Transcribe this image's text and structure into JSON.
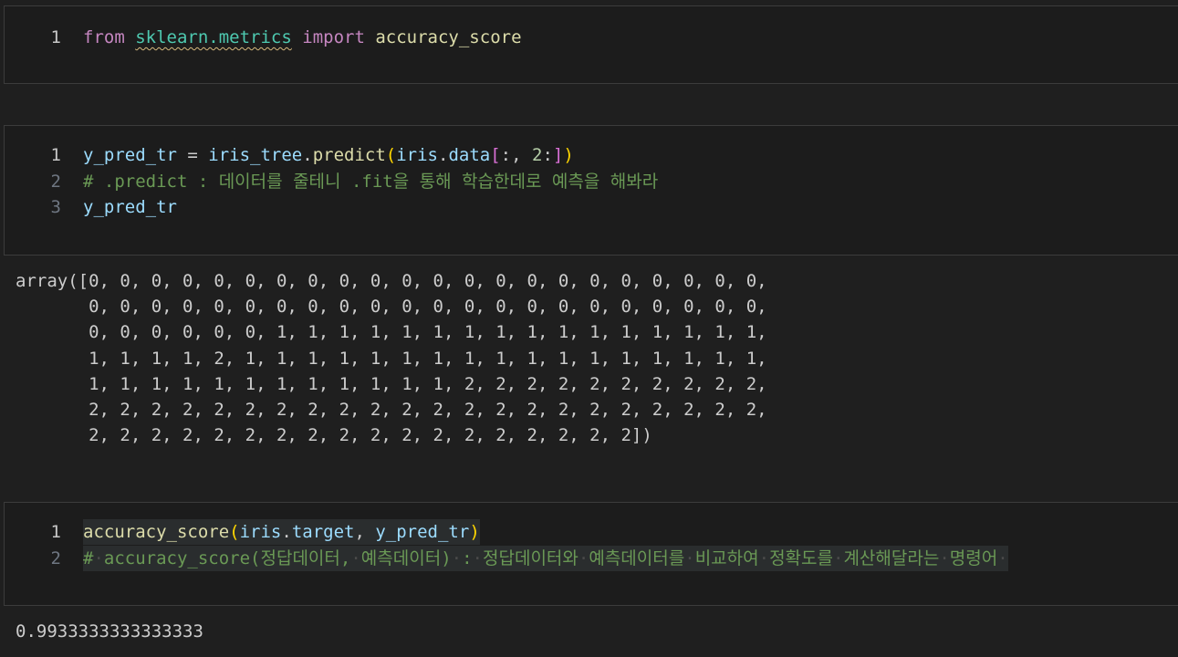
{
  "cells": [
    {
      "lines": [
        {
          "n": "1",
          "t": [
            {
              "c": "kw",
              "s": "from"
            },
            {
              "c": "",
              "s": " "
            },
            {
              "c": "mod squig",
              "s": "sklearn.metrics"
            },
            {
              "c": "",
              "s": " "
            },
            {
              "c": "kw",
              "s": "import"
            },
            {
              "c": "",
              "s": " "
            },
            {
              "c": "fn",
              "s": "accuracy_score"
            }
          ]
        }
      ]
    },
    {
      "lines": [
        {
          "n": "1",
          "t": [
            {
              "c": "var",
              "s": "y_pred_tr"
            },
            {
              "c": "",
              "s": " = "
            },
            {
              "c": "var",
              "s": "iris_tree"
            },
            {
              "c": "",
              "s": "."
            },
            {
              "c": "fn",
              "s": "predict"
            },
            {
              "c": "br1",
              "s": "("
            },
            {
              "c": "var",
              "s": "iris"
            },
            {
              "c": "",
              "s": "."
            },
            {
              "c": "var",
              "s": "data"
            },
            {
              "c": "br2",
              "s": "["
            },
            {
              "c": "",
              "s": ":, "
            },
            {
              "c": "num",
              "s": "2"
            },
            {
              "c": "",
              "s": ":"
            },
            {
              "c": "br2",
              "s": "]"
            },
            {
              "c": "br1",
              "s": ")"
            }
          ]
        },
        {
          "n": "2",
          "t": [
            {
              "c": "cm",
              "s": "# .predict : 데이터를 줄테니 .fit을 통해 학습한데로 예측을 해봐라"
            }
          ]
        },
        {
          "n": "3",
          "t": [
            {
              "c": "var",
              "s": "y_pred_tr"
            }
          ]
        }
      ]
    },
    {
      "lines": [
        {
          "n": "1",
          "hl": true,
          "t": [
            {
              "c": "fn",
              "s": "accuracy_score"
            },
            {
              "c": "br1",
              "s": "("
            },
            {
              "c": "var",
              "s": "iris"
            },
            {
              "c": "",
              "s": "."
            },
            {
              "c": "var",
              "s": "target"
            },
            {
              "c": "",
              "s": ", "
            },
            {
              "c": "var",
              "s": "y_pred_tr"
            },
            {
              "c": "br1",
              "s": ")"
            }
          ]
        },
        {
          "n": "2",
          "hl": true,
          "t": [
            {
              "c": "cm",
              "s": "#"
            },
            {
              "c": "dot",
              "s": "·"
            },
            {
              "c": "cm",
              "s": "accuracy_score(정답데이터,"
            },
            {
              "c": "dot",
              "s": "·"
            },
            {
              "c": "cm",
              "s": "예측데이터)"
            },
            {
              "c": "dot",
              "s": "·"
            },
            {
              "c": "cm",
              "s": ":"
            },
            {
              "c": "dot",
              "s": "·"
            },
            {
              "c": "cm",
              "s": "정답데이터와"
            },
            {
              "c": "dot",
              "s": "·"
            },
            {
              "c": "cm",
              "s": "예측데이터를"
            },
            {
              "c": "dot",
              "s": "·"
            },
            {
              "c": "cm",
              "s": "비교하여"
            },
            {
              "c": "dot",
              "s": "·"
            },
            {
              "c": "cm",
              "s": "정확도를"
            },
            {
              "c": "dot",
              "s": "·"
            },
            {
              "c": "cm",
              "s": "계산해달라는"
            },
            {
              "c": "dot",
              "s": "·"
            },
            {
              "c": "cm",
              "s": "명령어"
            },
            {
              "c": "dot",
              "s": "·"
            }
          ]
        }
      ]
    }
  ],
  "outputs": {
    "array": "array([0, 0, 0, 0, 0, 0, 0, 0, 0, 0, 0, 0, 0, 0, 0, 0, 0, 0, 0, 0, 0, 0,\n       0, 0, 0, 0, 0, 0, 0, 0, 0, 0, 0, 0, 0, 0, 0, 0, 0, 0, 0, 0, 0, 0,\n       0, 0, 0, 0, 0, 0, 1, 1, 1, 1, 1, 1, 1, 1, 1, 1, 1, 1, 1, 1, 1, 1,\n       1, 1, 1, 1, 2, 1, 1, 1, 1, 1, 1, 1, 1, 1, 1, 1, 1, 1, 1, 1, 1, 1,\n       1, 1, 1, 1, 1, 1, 1, 1, 1, 1, 1, 1, 2, 2, 2, 2, 2, 2, 2, 2, 2, 2,\n       2, 2, 2, 2, 2, 2, 2, 2, 2, 2, 2, 2, 2, 2, 2, 2, 2, 2, 2, 2, 2, 2,\n       2, 2, 2, 2, 2, 2, 2, 2, 2, 2, 2, 2, 2, 2, 2, 2, 2, 2])",
    "score": "0.9933333333333333"
  }
}
